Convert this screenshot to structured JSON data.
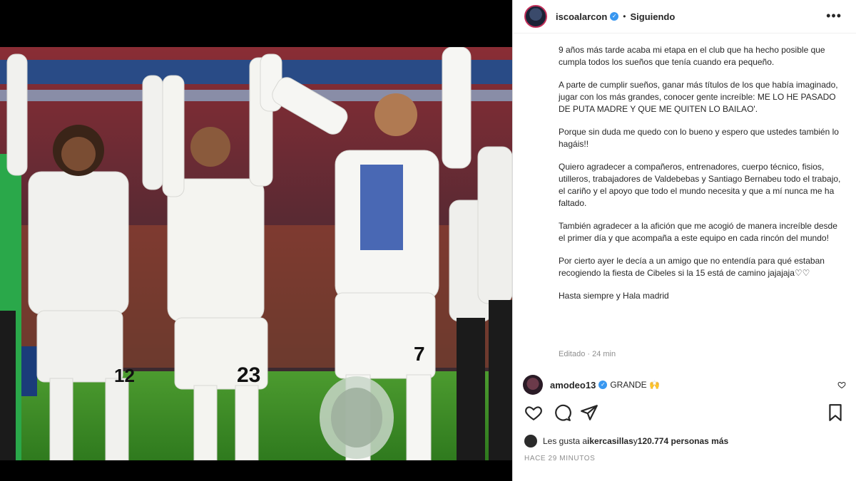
{
  "post": {
    "username": "iscoalarcon",
    "verified_mark": "✓",
    "separator": "•",
    "follow_status": "Siguiendo",
    "more_icon": "more-options-icon",
    "caption_paragraphs": [
      "9 años más tarde acaba mi etapa en el club que ha hecho posible que cumpla todos los sueños que tenía cuando era pequeño.",
      "A parte de cumplir sueños, ganar más títulos de los que había imaginado, jugar con los más grandes, conocer gente increíble: ME LO HE PASADO DE PUTA MADRE Y QUE ME QUITEN LO BAILAO'.",
      "Porque sin duda me quedo con lo bueno y espero que ustedes también lo hagáis!!",
      "Quiero agradecer a compañeros, entrenadores, cuerpo técnico, fisios, utilleros, trabajadores de Valdebebas y Santiago Bernabeu todo el trabajo, el cariño y el apoyo que todo el mundo necesita y que a mí nunca me ha faltado.",
      "También agradecer a la afición que me acogió de manera increíble desde el primer día y que acompaña a este equipo en cada rincón del mundo!",
      "Por cierto ayer le decía a un amigo que no entendía para qué estaban recogiendo la fiesta de Cibeles si la 15 está de camino jajajaja♡♡",
      "Hasta siempre y Hala madrid"
    ],
    "edited": "Editado · 24 min",
    "comment": {
      "username": "amodeo13",
      "verified_mark": "✓",
      "text": "GRANDE 🙌"
    },
    "likes": {
      "prefix": "Les gusta a ",
      "user": "ikercasillas",
      "middle": " y ",
      "count": "120.774 personas más"
    },
    "time_ago": "HACE 29 MINUTOS"
  },
  "colors": {
    "accent_blue": "#3897f0",
    "text": "#262626",
    "muted": "#8e8e8e",
    "border": "#dbdbdb"
  }
}
